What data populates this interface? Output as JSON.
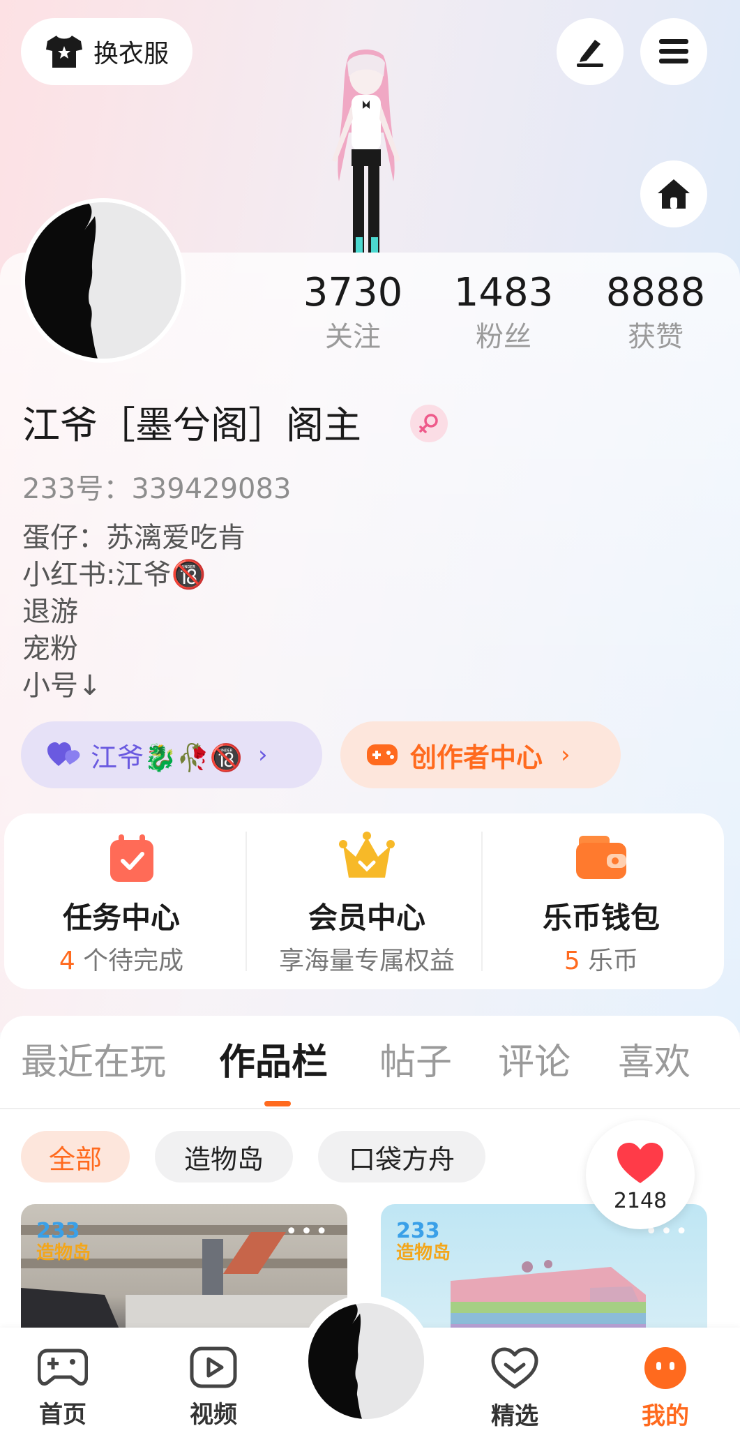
{
  "header": {
    "outfit_label": "换衣服"
  },
  "stats": [
    {
      "value": "3730",
      "label": "关注"
    },
    {
      "value": "1483",
      "label": "粉丝"
    },
    {
      "value": "8888",
      "label": "获赞"
    }
  ],
  "profile": {
    "name": "江爷［墨兮阁］阁主",
    "uid": "233号：339429083",
    "bio": [
      "蛋仔：苏漓爱吃肯",
      "小红书:江爷🔞",
      "退游",
      "宠粉",
      "小号↓"
    ]
  },
  "pills": {
    "group_label": "江爷🐉🥀🔞",
    "creator_label": "创作者中心"
  },
  "services": [
    {
      "title": "任务中心",
      "sub_num": "4",
      "sub_text": " 个待完成"
    },
    {
      "title": "会员中心",
      "sub_num": "",
      "sub_text": "享海量专属权益"
    },
    {
      "title": "乐币钱包",
      "sub_num": "5",
      "sub_text": " 乐币"
    }
  ],
  "tabs": [
    "最近在玩",
    "作品栏",
    "帖子",
    "评论",
    "喜欢"
  ],
  "chips": [
    "全部",
    "造物岛",
    "口袋方舟"
  ],
  "cards": [
    {
      "badge_top": "233",
      "badge_bottom": "造物岛"
    },
    {
      "badge_top": "233",
      "badge_bottom": "造物岛"
    }
  ],
  "like_count": "2148",
  "nav": [
    "首页",
    "视频",
    "精选",
    "我的"
  ],
  "colors": {
    "accent": "#ff6a1e",
    "purple": "#6a5ae0",
    "pill_purple_bg": "#e6e1f7",
    "pill_orange_bg": "#fde6dc"
  }
}
